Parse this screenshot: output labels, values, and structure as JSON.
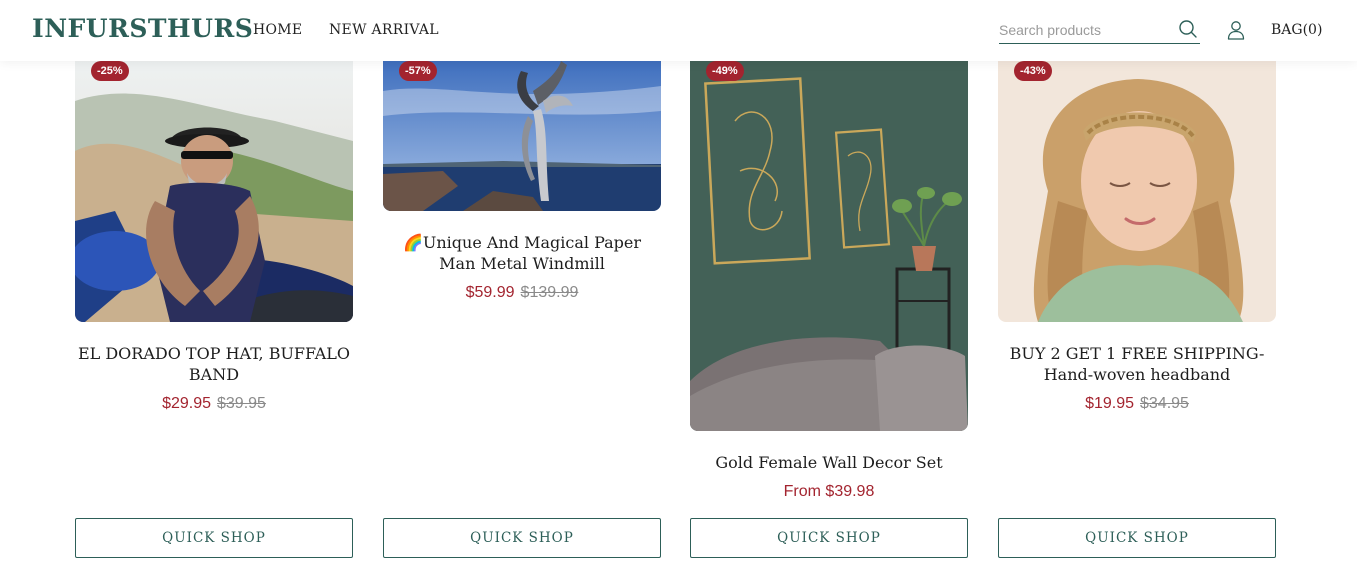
{
  "header": {
    "logo": "INFURSTHURS",
    "nav": [
      "HOME",
      "NEW ARRIVAL"
    ],
    "search_placeholder": "Search products",
    "bag_label": "BAG(0)"
  },
  "products": [
    {
      "badge": "-25%",
      "title": "EL DORADO TOP HAT, BUFFALO BAND",
      "price": "$29.95",
      "compare_price": "$39.95",
      "image": "biker in top hat on motorcycle",
      "button": "QUICK SHOP"
    },
    {
      "badge": "-57%",
      "title": "🌈Unique And Magical Paper Man Metal Windmill",
      "price": "$59.99",
      "compare_price": "$139.99",
      "image": "metal winged sculpture by the sea",
      "button": "QUICK SHOP"
    },
    {
      "badge": "-49%",
      "title": "Gold Female Wall Decor Set",
      "price": "From $39.98",
      "compare_price": "",
      "image": "gold line art frames on green wall",
      "button": "QUICK SHOP"
    },
    {
      "badge": "-43%",
      "title": "BUY 2 GET 1 FREE SHIPPING-Hand-woven headband",
      "price": "$19.95",
      "compare_price": "$34.95",
      "image": "woman wearing braided headband",
      "button": "QUICK SHOP"
    }
  ],
  "colors": {
    "brand": "#2d5f58",
    "sale": "#a3242f",
    "compare": "#8a8a8a"
  }
}
